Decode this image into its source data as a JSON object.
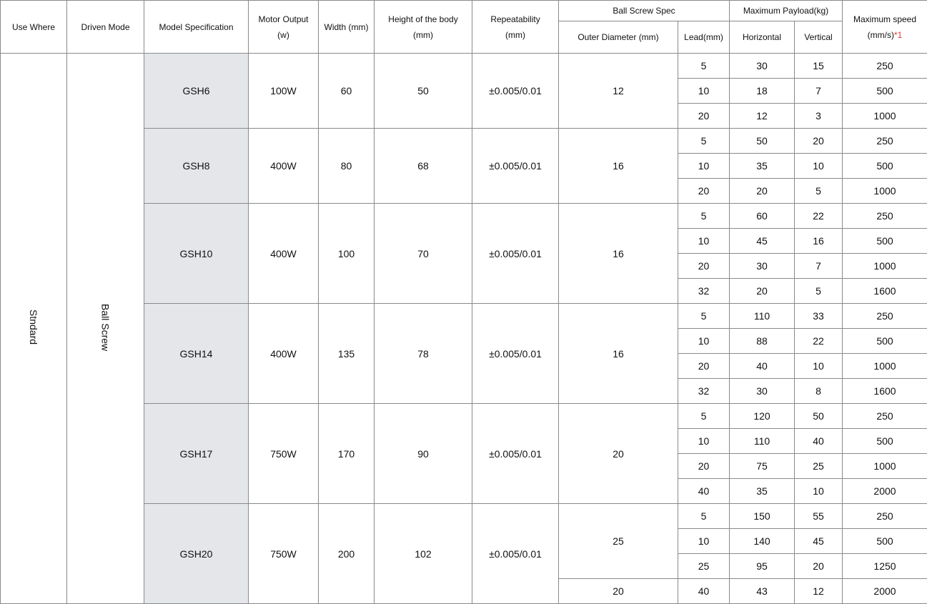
{
  "headers": {
    "use_where": "Use Where",
    "driven_mode": "Driven Mode",
    "model_spec": "Model Specification",
    "motor_output": "Motor Output",
    "motor_output_unit": "(w)",
    "width": "Width (mm)",
    "height_body": "Height of the body",
    "height_body_unit": "(mm)",
    "repeatability": "Repeatability",
    "repeatability_unit": "(mm)",
    "ball_screw_spec": "Ball Screw Spec",
    "outer_diameter": "Outer Diameter  (mm)",
    "lead": "Lead(mm)",
    "max_payload": "Maximum Payload(kg)",
    "horizontal": "Horizontal",
    "vertical": "Vertical",
    "max_speed": "Maximum speed",
    "max_speed_unit": "(mm/s)",
    "max_speed_note": "*1"
  },
  "use_where": "Stndard",
  "driven_mode": "Ball Screw",
  "models": [
    {
      "name": "GSH6",
      "motor": "100W",
      "width": "60",
      "height": "50",
      "repeat": "±0.005/0.01",
      "diameters": [
        {
          "value": "12",
          "rows": 3
        }
      ],
      "rows": [
        {
          "lead": "5",
          "h": "30",
          "v": "15",
          "speed": "250"
        },
        {
          "lead": "10",
          "h": "18",
          "v": "7",
          "speed": "500"
        },
        {
          "lead": "20",
          "h": "12",
          "v": "3",
          "speed": "1000"
        }
      ]
    },
    {
      "name": "GSH8",
      "motor": "400W",
      "width": "80",
      "height": "68",
      "repeat": "±0.005/0.01",
      "diameters": [
        {
          "value": "16",
          "rows": 3
        }
      ],
      "rows": [
        {
          "lead": "5",
          "h": "50",
          "v": "20",
          "speed": "250"
        },
        {
          "lead": "10",
          "h": "35",
          "v": "10",
          "speed": "500"
        },
        {
          "lead": "20",
          "h": "20",
          "v": "5",
          "speed": "1000"
        }
      ]
    },
    {
      "name": "GSH10",
      "motor": "400W",
      "width": "100",
      "height": "70",
      "repeat": "±0.005/0.01",
      "diameters": [
        {
          "value": "16",
          "rows": 4
        }
      ],
      "rows": [
        {
          "lead": "5",
          "h": "60",
          "v": "22",
          "speed": "250"
        },
        {
          "lead": "10",
          "h": "45",
          "v": "16",
          "speed": "500"
        },
        {
          "lead": "20",
          "h": "30",
          "v": "7",
          "speed": "1000"
        },
        {
          "lead": "32",
          "h": "20",
          "v": "5",
          "speed": "1600"
        }
      ]
    },
    {
      "name": "GSH14",
      "motor": "400W",
      "width": "135",
      "height": "78",
      "repeat": "±0.005/0.01",
      "diameters": [
        {
          "value": "16",
          "rows": 4
        }
      ],
      "rows": [
        {
          "lead": "5",
          "h": "110",
          "v": "33",
          "speed": "250"
        },
        {
          "lead": "10",
          "h": "88",
          "v": "22",
          "speed": "500"
        },
        {
          "lead": "20",
          "h": "40",
          "v": "10",
          "speed": "1000"
        },
        {
          "lead": "32",
          "h": "30",
          "v": "8",
          "speed": "1600"
        }
      ]
    },
    {
      "name": "GSH17",
      "motor": "750W",
      "width": "170",
      "height": "90",
      "repeat": "±0.005/0.01",
      "diameters": [
        {
          "value": "20",
          "rows": 4
        }
      ],
      "rows": [
        {
          "lead": "5",
          "h": "120",
          "v": "50",
          "speed": "250"
        },
        {
          "lead": "10",
          "h": "110",
          "v": "40",
          "speed": "500"
        },
        {
          "lead": "20",
          "h": "75",
          "v": "25",
          "speed": "1000"
        },
        {
          "lead": "40",
          "h": "35",
          "v": "10",
          "speed": "2000"
        }
      ]
    },
    {
      "name": "GSH20",
      "motor": "750W",
      "width": "200",
      "height": "102",
      "repeat": "±0.005/0.01",
      "diameters": [
        {
          "value": "25",
          "rows": 3
        },
        {
          "value": "20",
          "rows": 1
        }
      ],
      "rows": [
        {
          "lead": "5",
          "h": "150",
          "v": "55",
          "speed": "250"
        },
        {
          "lead": "10",
          "h": "140",
          "v": "45",
          "speed": "500"
        },
        {
          "lead": "25",
          "h": "95",
          "v": "20",
          "speed": "1250"
        },
        {
          "lead": "40",
          "h": "43",
          "v": "12",
          "speed": "2000"
        }
      ]
    }
  ]
}
